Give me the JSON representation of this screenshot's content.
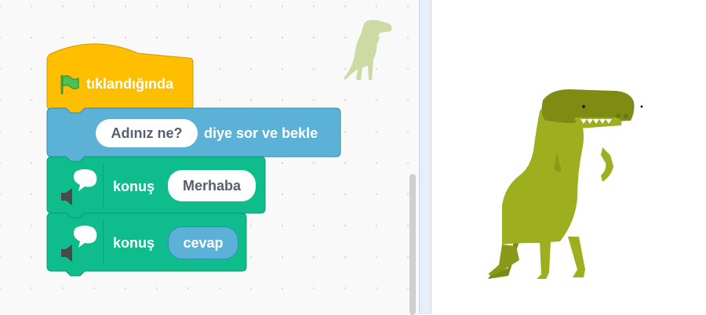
{
  "workspace": {
    "blocks": {
      "when_flag": {
        "label": "tıklandığında",
        "color": "#FFBF00",
        "icon": "green-flag-icon"
      },
      "ask": {
        "input": "Adınız ne?",
        "label": "diye sor ve bekle",
        "color": "#5CB1D6"
      },
      "say1": {
        "label": "konuş",
        "input": "Merhaba",
        "color": "#0FBD8C",
        "icon": "speech-bubble-speaker-icon"
      },
      "say2": {
        "label": "konuş",
        "reporter": "cevap",
        "color": "#0FBD8C",
        "reporter_color": "#5CB1D6",
        "icon": "speech-bubble-speaker-icon"
      }
    },
    "sprite_ghost": "dinosaur-icon"
  },
  "stage": {
    "sprite": "dinosaur-icon",
    "sprite_color": "#9DAF1F"
  }
}
